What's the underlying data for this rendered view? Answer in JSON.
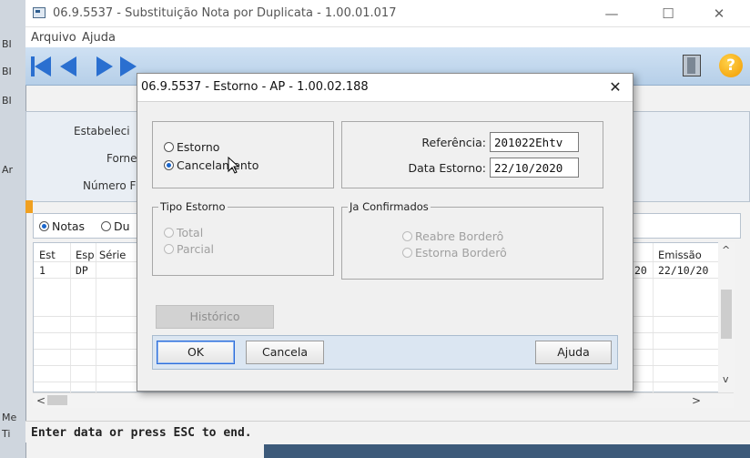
{
  "background": {
    "left_fragments": [
      "BI",
      "BI",
      "BI",
      "Ar",
      "Me",
      "Ti"
    ]
  },
  "main_window": {
    "title": "06.9.5537 - Substituição Nota por Duplicata - 1.00.01.017",
    "controls": {
      "minimize": "—",
      "maximize": "☐",
      "close": "✕"
    },
    "menu": [
      "Arquivo",
      "Ajuda"
    ],
    "header_labels": [
      "Estabeleci",
      "Forne",
      "Número F"
    ],
    "radio_options": [
      {
        "label": "Notas",
        "selected": true
      },
      {
        "label": "Du",
        "selected": false
      }
    ],
    "grid": {
      "columns": [
        "Est",
        "Esp",
        "Série",
        "Emissão"
      ],
      "row": {
        "est": "1",
        "esp": "DP",
        "partial": "20",
        "emissao": "22/10/20"
      }
    },
    "scroll_glyphs": {
      "left": "<",
      "right": ">",
      "up": "^",
      "down": "v"
    },
    "status": "Enter data or press ESC to end.",
    "help_icon_text": "?"
  },
  "dialog": {
    "title": "06.9.5537 - Estorno - AP - 1.00.02.188",
    "close_label": "✕",
    "mode_options": [
      {
        "label": "Estorno",
        "selected": false
      },
      {
        "label": "Cancelamento",
        "selected": true
      }
    ],
    "referencia_label": "Referência:",
    "referencia_value": "201022Ehtv",
    "data_estorno_label": "Data Estorno:",
    "data_estorno_value": "22/10/2020",
    "tipo_estorno": {
      "legend": "Tipo Estorno",
      "options": [
        {
          "label": "Total",
          "selected": true,
          "enabled": false
        },
        {
          "label": "Parcial",
          "selected": false,
          "enabled": false
        }
      ]
    },
    "ja_confirmados": {
      "legend": "Ja Confirmados",
      "options": [
        {
          "label": "Reabre Borderô",
          "selected": true,
          "enabled": false
        },
        {
          "label": "Estorna Borderô",
          "selected": false,
          "enabled": false
        }
      ]
    },
    "historico_label": "Histórico",
    "ok_label": "OK",
    "cancela_label": "Cancela",
    "ajuda_label": "Ajuda"
  },
  "colors": {
    "accent": "#1a66cc",
    "toolbar": "#c4d8ec",
    "help_icon": "#f29a00"
  }
}
